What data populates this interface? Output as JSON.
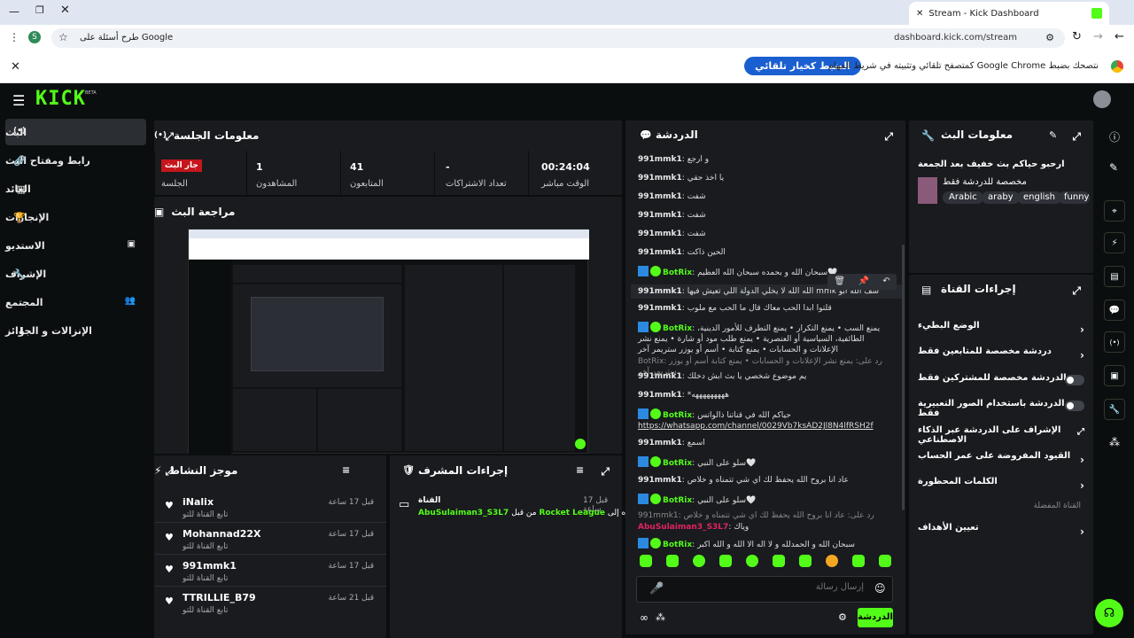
{
  "browser": {
    "tab_title": "Stream - Kick Dashboard",
    "url": "dashboard.kick.com/stream",
    "search_chip": "طرح أسئلة على Google",
    "profile_initial": "S",
    "infobar_text": "نتصحك بضبط Google Chrome كمتصفح تلقائي وتثبيته في شريط المهام",
    "infobar_button": "الضبط كخيار تلقائي"
  },
  "brand": {
    "logo": "KICK",
    "beta": "BETA",
    "accent": "#53fc18"
  },
  "nav": {
    "items": [
      {
        "label": "البث"
      },
      {
        "label": "رابط ومفتاح البث"
      },
      {
        "label": "العائد"
      },
      {
        "label": "الإنجازات"
      },
      {
        "label": "الاستديو"
      },
      {
        "label": "الإشراف"
      },
      {
        "label": "المجتمع"
      },
      {
        "label": "الإنزالات و الجوائز"
      }
    ]
  },
  "session": {
    "title": "معلومات الجلسة",
    "live_badge": "جار البث",
    "live_label": "الجلسة",
    "stats": [
      {
        "value": "00:24:04",
        "label": "الوقت مباشر"
      },
      {
        "value": "-",
        "label": "تعداد الاشتراكات"
      },
      {
        "value": "41",
        "label": "المتابعون"
      },
      {
        "value": "1",
        "label": "المشاهدون"
      }
    ]
  },
  "preview": {
    "title": "مراجعة البث"
  },
  "activity": {
    "title": "موجز النشاط",
    "items": [
      {
        "name": "iNalix",
        "sub": "تابع القناة للتو",
        "time": "قبل 17 ساعة"
      },
      {
        "name": "Mohannad22X",
        "sub": "تابع القناة للتو",
        "time": "قبل 17 ساعة"
      },
      {
        "name": "991mmk1",
        "sub": "تابع القناة للتو",
        "time": "قبل 17 ساعة"
      },
      {
        "name": "TTRILLIE_B79",
        "sub": "تابع القناة للتو",
        "time": "قبل 21 ساعة"
      }
    ]
  },
  "modactions": {
    "title": "إجراءات المشرف",
    "item": {
      "heading": "القناة",
      "time": "قبل 17 ساعة",
      "user": "AbuSulaiman3_S3L7",
      "mid": "من قبل",
      "category": "Rocket League",
      "tail": "تم تغييره إلى"
    }
  },
  "chat": {
    "title": "الدردشة",
    "lines": [
      {
        "user": "991mmk1",
        "text": "و ارجع"
      },
      {
        "user": "991mmk1",
        "text": "يا اخذ حقي"
      },
      {
        "user": "991mmk1",
        "text": "شفت"
      },
      {
        "user": "991mmk1",
        "text": "شفت"
      },
      {
        "user": "991mmk1",
        "text": "شفت"
      },
      {
        "user": "991mmk1",
        "text": "الحين ذاكت"
      },
      {
        "user": "BotRix",
        "text": "سبحان الله و بحمده سبحان الله العظيم🤍"
      },
      {
        "user": "991mmk1",
        "text": "الله الله لا يخلي الدولة اللي تعيش فيها mmk شف الله ابو"
      },
      {
        "user": "991mmk1",
        "text": "قلتوا ابدا الحب معاك قال ما الحب مع ملوب"
      },
      {
        "user": "BotRix",
        "text": "يمنع السب • يمنع التكرار • يمنع التطرف للأمور الدينية، الطائفية، السياسية أو العنصرية • يمنع طلب مود أو شارة • يمنع نشر الإعلانات و الحسابات • يمنع كتابة • أسم أو يوزر ستريمر آخر"
      },
      {
        "user": "BotRix",
        "text": "رد على: يمنع نشر الإعلانات و الحسابات • يمنع كتابة أسم أو يوزر ستريمر آخر"
      },
      {
        "user": "991mmk1",
        "text": "يم موضوع شخصي يا بث ابش دخلك"
      },
      {
        "user": "991mmk1",
        "text": "*هههههههههه"
      },
      {
        "user": "BotRix",
        "text": "حياكم الله في قناتنا ذالواتس"
      },
      {
        "user": "",
        "text": "https://whatsapp.com/channel/0029Vb7ksAD2Jl8N4lfRSH2f"
      },
      {
        "user": "991mmk1",
        "text": "اسمع"
      },
      {
        "user": "BotRix",
        "text": "سلو على النبي🤍"
      },
      {
        "user": "991mmk1",
        "text": "عاد انا بروح الله يحفظ لك اي شي تتمناه و خلاص"
      },
      {
        "user": "BotRix",
        "text": "سلو على النبي🤍"
      },
      {
        "user": "991mmk1",
        "text": "رد على: عاد انا بروح الله يحفظ لك اي شي تتمناه و خلاص"
      },
      {
        "user": "AbuSulaiman3_S3L7",
        "text": "وياك"
      },
      {
        "user": "BotRix",
        "text": "سبحان الله و الحمدلله و لا اله الا الله و الله اكبر"
      }
    ],
    "input_placeholder": "إرسال رسالة",
    "send_label": "الدردشة"
  },
  "streaminfo": {
    "title": "معلومات البث",
    "stream_title": "ارحبو حياكم بث خفيف بعد الجمعة",
    "tagline": "مخصصة للدردشة فقط",
    "tags": [
      "Arabic",
      "araby",
      "english",
      "funny"
    ]
  },
  "channelactions": {
    "title": "إجراءات القناة",
    "rows": [
      {
        "label": "الوضع البطيء",
        "control": "chevron"
      },
      {
        "label": "دردشة مخصصة للمتابعين فقط",
        "control": "chevron"
      },
      {
        "label": "الدردشة مخصصة للمشتركين فقط",
        "control": "toggle"
      },
      {
        "label": "الدردشة باستخدام الصور التعبيرية فقط",
        "control": "toggle"
      },
      {
        "label": "الإشراف على الدردشة عبر الذكاء الاصطناعي",
        "control": "link"
      },
      {
        "label": "القيود المفروضة على عمر الحساب",
        "control": "chevron"
      },
      {
        "label": "الكلمات المحظورة",
        "control": "chevron"
      }
    ],
    "section": "القناة المفضلة",
    "last_row": "تعيين الأهداف"
  }
}
